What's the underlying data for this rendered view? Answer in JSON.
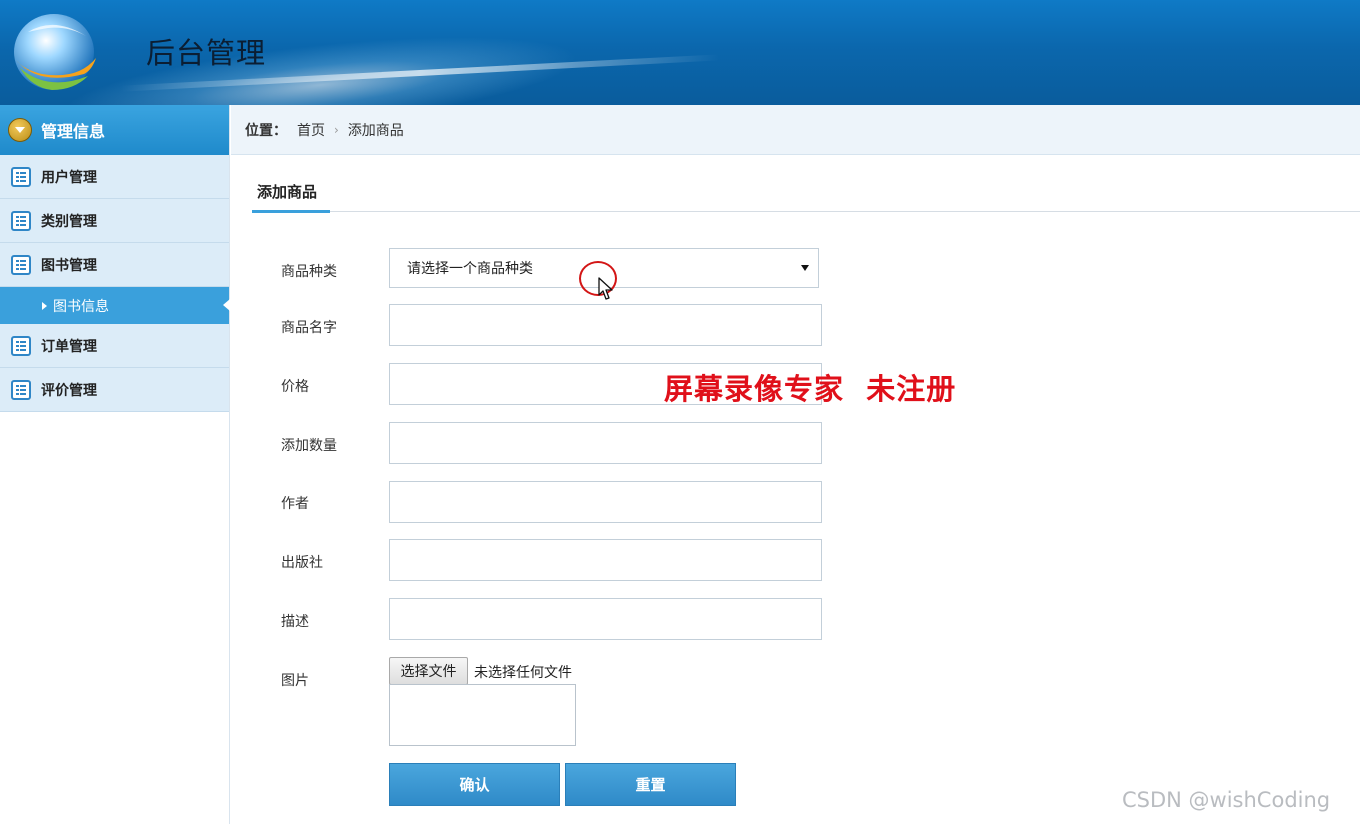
{
  "app": {
    "title": "后台管理"
  },
  "sidebar": {
    "header": "管理信息",
    "items": [
      {
        "label": "用户管理"
      },
      {
        "label": "类别管理"
      },
      {
        "label": "图书管理"
      },
      {
        "label": "图书信息",
        "active": true,
        "sub": true
      },
      {
        "label": "订单管理"
      },
      {
        "label": "评价管理"
      }
    ]
  },
  "breadcrumb": {
    "label": "位置：",
    "home": "首页",
    "current": "添加商品"
  },
  "tab": {
    "title": "添加商品"
  },
  "form": {
    "category": {
      "label": "商品种类",
      "selected": "请选择一个商品种类"
    },
    "name": {
      "label": "商品名字",
      "value": ""
    },
    "price": {
      "label": "价格",
      "value": ""
    },
    "quantity": {
      "label": "添加数量",
      "value": ""
    },
    "author": {
      "label": "作者",
      "value": ""
    },
    "publisher": {
      "label": "出版社",
      "value": ""
    },
    "description": {
      "label": "描述",
      "value": ""
    },
    "image": {
      "label": "图片",
      "button": "选择文件",
      "status": "未选择任何文件"
    },
    "confirm_button": "确认",
    "reset_button": "重置"
  },
  "overlay": {
    "recorder_watermark": "屏幕录像专家  未注册",
    "csdn_watermark": "CSDN @wishCoding"
  },
  "colors": {
    "header_bg": "#0b67ad",
    "accent": "#3aa0dc",
    "sidebar_item_bg": "#dcecf8",
    "watermark_red": "#e0101a"
  }
}
